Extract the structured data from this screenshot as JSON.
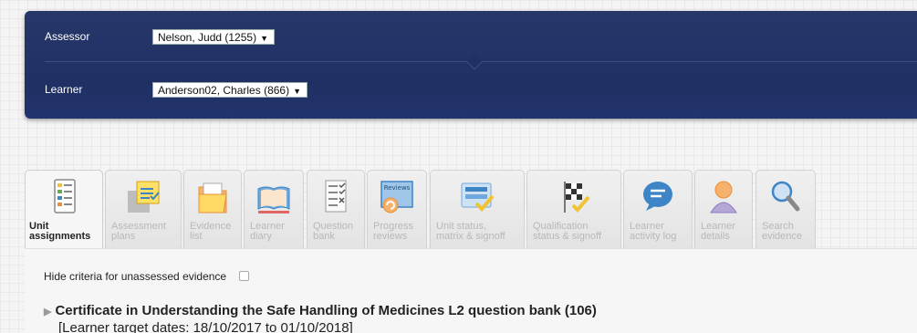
{
  "header": {
    "assessor_label": "Assessor",
    "assessor_value": "Nelson, Judd (1255)",
    "learner_label": "Learner",
    "learner_value": "Anderson02, Charles (866)",
    "dropdown_arrow": "▼"
  },
  "tabs": [
    {
      "label": "Unit\nassignments",
      "icon": "unit-assignments-icon",
      "active": true
    },
    {
      "label": "Assessment\nplans",
      "icon": "assessment-plans-icon",
      "active": false
    },
    {
      "label": "Evidence\nlist",
      "icon": "evidence-list-icon",
      "active": false
    },
    {
      "label": "Learner\ndiary",
      "icon": "learner-diary-icon",
      "active": false
    },
    {
      "label": "Question\nbank",
      "icon": "question-bank-icon",
      "active": false
    },
    {
      "label": "Progress\nreviews",
      "icon": "progress-reviews-icon",
      "active": false
    },
    {
      "label": "Unit status,\nmatrix & signoff",
      "icon": "unit-status-icon",
      "active": false
    },
    {
      "label": "Qualification\nstatus & signoff",
      "icon": "qualification-status-icon",
      "active": false
    },
    {
      "label": "Learner\nactivity log",
      "icon": "learner-activity-log-icon",
      "active": false
    },
    {
      "label": "Learner\ndetails",
      "icon": "learner-details-icon",
      "active": false
    },
    {
      "label": "Search\nevidence",
      "icon": "search-evidence-icon",
      "active": false
    }
  ],
  "progress_reviews_icon_text": "Reviews",
  "content": {
    "hide_criteria_label": "Hide criteria for unassessed evidence",
    "hide_criteria_checked": false,
    "cert_title": "Certificate in Understanding the Safe Handling of Medicines L2 question bank (106)",
    "cert_dates": "[Learner target dates: 18/10/2017 to 01/10/2018]"
  },
  "colors": {
    "header_bg": "#1f3064",
    "page_bg": "#f4f4f4",
    "tab_bg": "#e8e8e8",
    "inactive_tab_text": "#b8b8b8"
  }
}
